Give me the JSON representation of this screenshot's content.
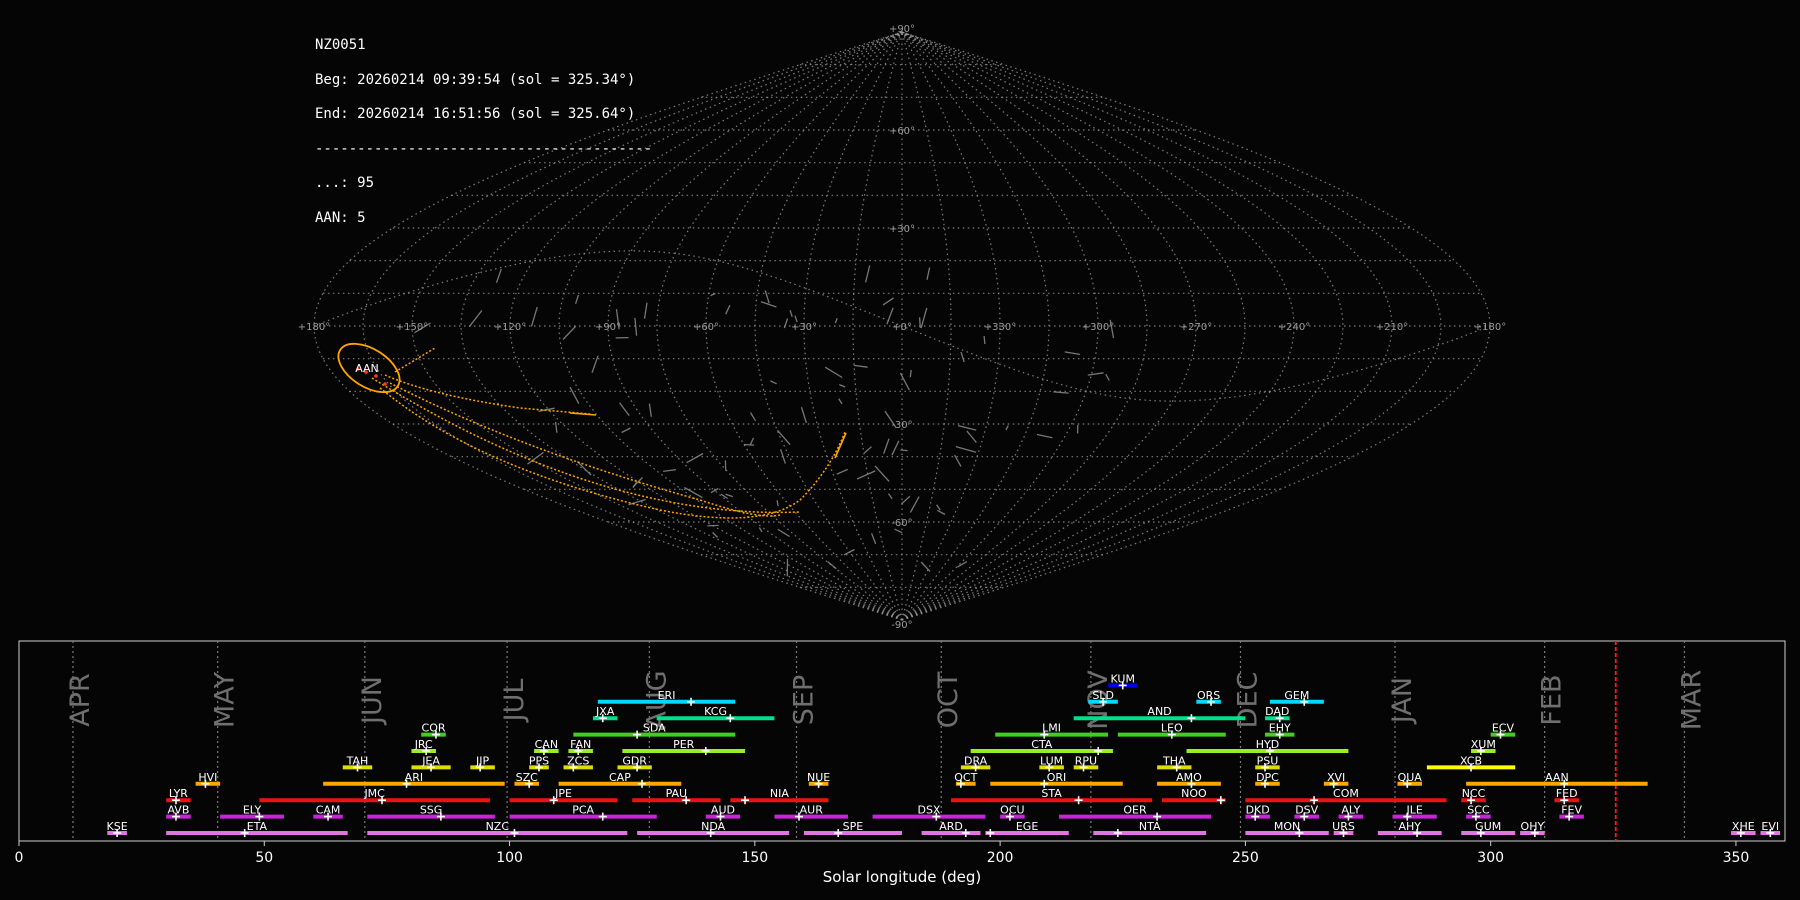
{
  "info": {
    "station": "NZ0051",
    "beg": "Beg: 20260214 09:39:54 (sol = 325.34°)",
    "end": "End: 20260214 16:51:56 (sol = 325.64°)",
    "sep": "----------------------------------------",
    "sporadic": "...: 95",
    "shower": "AAN: 5"
  },
  "sky": {
    "lon_labels": [
      "+180°",
      "+150°",
      "+120°",
      "+90°",
      "+60°",
      "+30°",
      "+0°",
      "+330°",
      "+300°",
      "+270°",
      "+240°",
      "+210°",
      "+180°"
    ],
    "lat_labels": [
      "+90°",
      "+60°",
      "+30°",
      "-30°",
      "-60°",
      "-90°"
    ],
    "radiant_label": "AAN",
    "radiant_color": "#ffa500"
  },
  "chart_data": {
    "type": "gantt",
    "xlabel": "Solar longitude (deg)",
    "xlim": [
      0,
      360
    ],
    "xticks": [
      0,
      50,
      100,
      150,
      200,
      250,
      300,
      350
    ],
    "months": [
      {
        "name": "APR",
        "sol": 11
      },
      {
        "name": "MAY",
        "sol": 40.5
      },
      {
        "name": "JUN",
        "sol": 70.5
      },
      {
        "name": "JUL",
        "sol": 99.5
      },
      {
        "name": "AUG",
        "sol": 128.5
      },
      {
        "name": "SEP",
        "sol": 158.5
      },
      {
        "name": "OCT",
        "sol": 188
      },
      {
        "name": "NOV",
        "sol": 218.5
      },
      {
        "name": "DEC",
        "sol": 249
      },
      {
        "name": "JAN",
        "sol": 280.5
      },
      {
        "name": "FEB",
        "sol": 311
      },
      {
        "name": "MAR",
        "sol": 339.5
      }
    ],
    "current_sol": 325.5,
    "showers": [
      {
        "code": "KUM",
        "start": 222,
        "end": 228,
        "peak": 225,
        "row": 9,
        "color": "#0000dd"
      },
      {
        "code": "ERI",
        "start": 118,
        "end": 146,
        "peak": 137,
        "row": 8,
        "color": "#00d8ff"
      },
      {
        "code": "SLD",
        "start": 218,
        "end": 224,
        "peak": 221,
        "row": 8,
        "color": "#00d8ff"
      },
      {
        "code": "ORS",
        "start": 240,
        "end": 245,
        "peak": 243,
        "row": 8,
        "color": "#00d8ff"
      },
      {
        "code": "GEM",
        "start": 255,
        "end": 266,
        "peak": 262,
        "row": 8,
        "color": "#00d8ff"
      },
      {
        "code": "JXA",
        "start": 117,
        "end": 122,
        "peak": 119,
        "row": 7,
        "color": "#00e08a"
      },
      {
        "code": "KCG",
        "start": 130,
        "end": 154,
        "peak": 145,
        "row": 7,
        "color": "#00e08a"
      },
      {
        "code": "AND",
        "start": 215,
        "end": 250,
        "peak": 239,
        "row": 7,
        "color": "#00e08a"
      },
      {
        "code": "DAD",
        "start": 254,
        "end": 259,
        "peak": 257,
        "row": 7,
        "color": "#00e08a"
      },
      {
        "code": "COR",
        "start": 82,
        "end": 87,
        "peak": 85,
        "row": 6,
        "color": "#44cc22"
      },
      {
        "code": "SDA",
        "start": 113,
        "end": 146,
        "peak": 126,
        "row": 6,
        "color": "#44cc22"
      },
      {
        "code": "LMI",
        "start": 199,
        "end": 222,
        "peak": 209,
        "row": 6,
        "color": "#44cc22"
      },
      {
        "code": "LEO",
        "start": 224,
        "end": 246,
        "peak": 235,
        "row": 6,
        "color": "#44cc22"
      },
      {
        "code": "EHY",
        "start": 254,
        "end": 260,
        "peak": 257,
        "row": 6,
        "color": "#44cc22"
      },
      {
        "code": "ECV",
        "start": 300,
        "end": 305,
        "peak": 302,
        "row": 6,
        "color": "#44cc22"
      },
      {
        "code": "JRC",
        "start": 80,
        "end": 85,
        "peak": 83,
        "row": 5,
        "color": "#99ee22"
      },
      {
        "code": "CAN",
        "start": 105,
        "end": 110,
        "peak": 107,
        "row": 5,
        "color": "#99ee22"
      },
      {
        "code": "FAN",
        "start": 112,
        "end": 117,
        "peak": 114,
        "row": 5,
        "color": "#99ee22"
      },
      {
        "code": "PER",
        "start": 123,
        "end": 148,
        "peak": 140,
        "row": 5,
        "color": "#99ee22"
      },
      {
        "code": "CTA",
        "start": 194,
        "end": 223,
        "peak": 220,
        "row": 5,
        "color": "#99ee22"
      },
      {
        "code": "HYD",
        "start": 238,
        "end": 271,
        "peak": 255,
        "row": 5,
        "color": "#99ee22"
      },
      {
        "code": "XUM",
        "start": 296,
        "end": 301,
        "peak": 298,
        "row": 5,
        "color": "#99ee22"
      },
      {
        "code": "TAH",
        "start": 66,
        "end": 72,
        "peak": 69,
        "row": 4,
        "color": "#dddd00"
      },
      {
        "code": "JEA",
        "start": 80,
        "end": 88,
        "peak": 84,
        "row": 4,
        "color": "#dddd00"
      },
      {
        "code": "JIP",
        "start": 92,
        "end": 97,
        "peak": 94,
        "row": 4,
        "color": "#dddd00"
      },
      {
        "code": "PPS",
        "start": 104,
        "end": 108,
        "peak": 106,
        "row": 4,
        "color": "#dddd00"
      },
      {
        "code": "ZCS",
        "start": 111,
        "end": 117,
        "peak": 113,
        "row": 4,
        "color": "#dddd00"
      },
      {
        "code": "GDR",
        "start": 122,
        "end": 129,
        "peak": 126,
        "row": 4,
        "color": "#dddd00"
      },
      {
        "code": "DRA",
        "start": 192,
        "end": 198,
        "peak": 195,
        "row": 4,
        "color": "#dddd00"
      },
      {
        "code": "LUM",
        "start": 208,
        "end": 213,
        "peak": 210,
        "row": 4,
        "color": "#dddd00"
      },
      {
        "code": "RPU",
        "start": 215,
        "end": 220,
        "peak": 217,
        "row": 4,
        "color": "#dddd00"
      },
      {
        "code": "THA",
        "start": 232,
        "end": 239,
        "peak": 236,
        "row": 4,
        "color": "#dddd00"
      },
      {
        "code": "PSU",
        "start": 252,
        "end": 257,
        "peak": 254,
        "row": 4,
        "color": "#dddd00"
      },
      {
        "code": "XCB",
        "start": 287,
        "end": 305,
        "peak": 296,
        "row": 4,
        "color": "#ffff00"
      },
      {
        "code": "HVI",
        "start": 36,
        "end": 41,
        "peak": 38,
        "row": 3,
        "color": "#ffa500"
      },
      {
        "code": "ARI",
        "start": 62,
        "end": 99,
        "peak": 79,
        "row": 3,
        "color": "#ffa500"
      },
      {
        "code": "SZC",
        "start": 101,
        "end": 106,
        "peak": 104,
        "row": 3,
        "color": "#ffa500"
      },
      {
        "code": "CAP",
        "start": 110,
        "end": 135,
        "peak": 127,
        "row": 3,
        "color": "#ffa500"
      },
      {
        "code": "NUE",
        "start": 161,
        "end": 165,
        "peak": 163,
        "row": 3,
        "color": "#ffa500"
      },
      {
        "code": "OCT",
        "start": 191,
        "end": 195,
        "peak": 192,
        "row": 3,
        "color": "#ffa500"
      },
      {
        "code": "ORI",
        "start": 198,
        "end": 225,
        "peak": 209,
        "row": 3,
        "color": "#ffa500"
      },
      {
        "code": "AMO",
        "start": 232,
        "end": 245,
        "peak": 239,
        "row": 3,
        "color": "#ffa500"
      },
      {
        "code": "DPC",
        "start": 252,
        "end": 257,
        "peak": 254,
        "row": 3,
        "color": "#ffa500"
      },
      {
        "code": "XVI",
        "start": 266,
        "end": 271,
        "peak": 268,
        "row": 3,
        "color": "#ffa500"
      },
      {
        "code": "QUA",
        "start": 281,
        "end": 286,
        "peak": 283,
        "row": 3,
        "color": "#ffa500"
      },
      {
        "code": "AAN",
        "start": 295,
        "end": 332,
        "peak": 315,
        "row": 3,
        "color": "#ffa500"
      },
      {
        "code": "LYR",
        "start": 30,
        "end": 35,
        "peak": 32,
        "row": 2,
        "color": "#ee1111"
      },
      {
        "code": "JMC",
        "start": 49,
        "end": 96,
        "peak": 74,
        "row": 2,
        "color": "#ee1111"
      },
      {
        "code": "JPE",
        "start": 100,
        "end": 122,
        "peak": 109,
        "row": 2,
        "color": "#ee1111"
      },
      {
        "code": "PAU",
        "start": 125,
        "end": 143,
        "peak": 136,
        "row": 2,
        "color": "#ee1111"
      },
      {
        "code": "NIA",
        "start": 145,
        "end": 165,
        "peak": 148,
        "row": 2,
        "color": "#ee1111"
      },
      {
        "code": "STA",
        "start": 190,
        "end": 231,
        "peak": 216,
        "row": 2,
        "color": "#ee1111"
      },
      {
        "code": "NOO",
        "start": 233,
        "end": 246,
        "peak": 245,
        "row": 2,
        "color": "#ee1111"
      },
      {
        "code": "COM",
        "start": 250,
        "end": 291,
        "peak": 264,
        "row": 2,
        "color": "#ee1111"
      },
      {
        "code": "NCC",
        "start": 294,
        "end": 299,
        "peak": 296,
        "row": 2,
        "color": "#ee1111"
      },
      {
        "code": "FED",
        "start": 313,
        "end": 318,
        "peak": 315,
        "row": 2,
        "color": "#ee1111"
      },
      {
        "code": "AVB",
        "start": 30,
        "end": 35,
        "peak": 32,
        "row": 1,
        "color": "#cc22dd"
      },
      {
        "code": "ELY",
        "start": 41,
        "end": 54,
        "peak": 49,
        "row": 1,
        "color": "#cc22dd"
      },
      {
        "code": "CAM",
        "start": 60,
        "end": 66,
        "peak": 63,
        "row": 1,
        "color": "#cc22dd"
      },
      {
        "code": "SSG",
        "start": 71,
        "end": 97,
        "peak": 86,
        "row": 1,
        "color": "#cc22dd"
      },
      {
        "code": "PCA",
        "start": 100,
        "end": 130,
        "peak": 119,
        "row": 1,
        "color": "#cc22dd"
      },
      {
        "code": "AUD",
        "start": 140,
        "end": 147,
        "peak": 143,
        "row": 1,
        "color": "#cc22dd"
      },
      {
        "code": "AUR",
        "start": 154,
        "end": 169,
        "peak": 159,
        "row": 1,
        "color": "#cc22dd"
      },
      {
        "code": "DSX",
        "start": 174,
        "end": 197,
        "peak": 187,
        "row": 1,
        "color": "#cc22dd"
      },
      {
        "code": "OCU",
        "start": 200,
        "end": 205,
        "peak": 202,
        "row": 1,
        "color": "#cc22dd"
      },
      {
        "code": "OER",
        "start": 212,
        "end": 243,
        "peak": 232,
        "row": 1,
        "color": "#cc22dd"
      },
      {
        "code": "DKD",
        "start": 250,
        "end": 255,
        "peak": 252,
        "row": 1,
        "color": "#cc22dd"
      },
      {
        "code": "DSV",
        "start": 260,
        "end": 265,
        "peak": 262,
        "row": 1,
        "color": "#cc22dd"
      },
      {
        "code": "ALY",
        "start": 269,
        "end": 274,
        "peak": 271,
        "row": 1,
        "color": "#cc22dd"
      },
      {
        "code": "JLE",
        "start": 280,
        "end": 289,
        "peak": 283,
        "row": 1,
        "color": "#cc22dd"
      },
      {
        "code": "SCC",
        "start": 295,
        "end": 300,
        "peak": 297,
        "row": 1,
        "color": "#cc22dd"
      },
      {
        "code": "FEV",
        "start": 314,
        "end": 319,
        "peak": 316,
        "row": 1,
        "color": "#cc22dd"
      },
      {
        "code": "KSE",
        "start": 18,
        "end": 22,
        "peak": 20,
        "row": 0,
        "color": "#dd77dd"
      },
      {
        "code": "ETA",
        "start": 30,
        "end": 67,
        "peak": 46,
        "row": 0,
        "color": "#dd77dd"
      },
      {
        "code": "NZC",
        "start": 71,
        "end": 124,
        "peak": 101,
        "row": 0,
        "color": "#dd77dd"
      },
      {
        "code": "NDA",
        "start": 126,
        "end": 157,
        "peak": 141,
        "row": 0,
        "color": "#dd77dd"
      },
      {
        "code": "SPE",
        "start": 160,
        "end": 180,
        "peak": 167,
        "row": 0,
        "color": "#dd77dd"
      },
      {
        "code": "ARD",
        "start": 184,
        "end": 196,
        "peak": 193,
        "row": 0,
        "color": "#dd77dd"
      },
      {
        "code": "EGE",
        "start": 197,
        "end": 214,
        "peak": 198,
        "row": 0,
        "color": "#dd77dd"
      },
      {
        "code": "NTA",
        "start": 219,
        "end": 242,
        "peak": 224,
        "row": 0,
        "color": "#dd77dd"
      },
      {
        "code": "MON",
        "start": 250,
        "end": 267,
        "peak": 261,
        "row": 0,
        "color": "#dd77dd"
      },
      {
        "code": "URS",
        "start": 268,
        "end": 272,
        "peak": 270,
        "row": 0,
        "color": "#dd77dd"
      },
      {
        "code": "AHY",
        "start": 277,
        "end": 290,
        "peak": 285,
        "row": 0,
        "color": "#dd77dd"
      },
      {
        "code": "GUM",
        "start": 294,
        "end": 305,
        "peak": 298,
        "row": 0,
        "color": "#dd77dd"
      },
      {
        "code": "OHY",
        "start": 306,
        "end": 311,
        "peak": 309,
        "row": 0,
        "color": "#dd77dd"
      },
      {
        "code": "XHE",
        "start": 349,
        "end": 354,
        "peak": 351,
        "row": 0,
        "color": "#dd77dd"
      },
      {
        "code": "EVI",
        "start": 355,
        "end": 359,
        "peak": 357,
        "row": 0,
        "color": "#dd77dd"
      }
    ]
  }
}
